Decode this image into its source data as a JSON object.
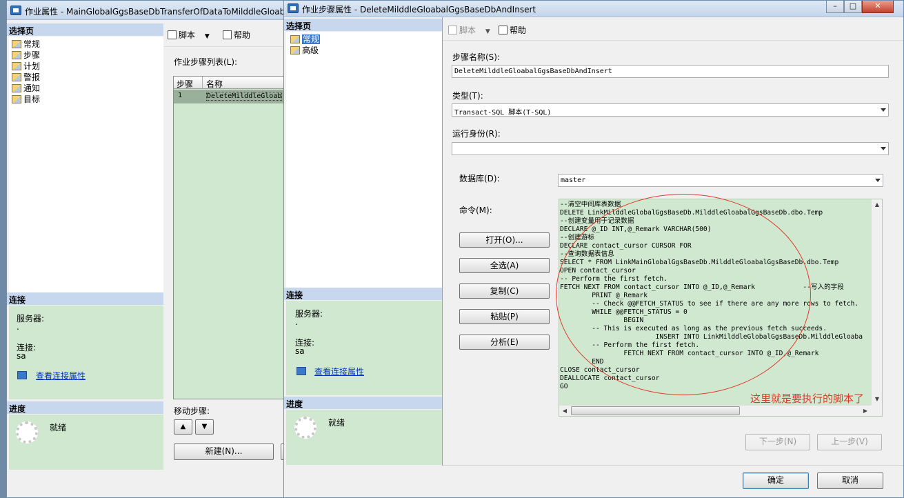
{
  "back_window": {
    "title": "作业属性 - MainGlobalGgsBaseDbTransferOfDataToMilddleGloab",
    "select_page_header": "选择页",
    "nav": [
      "常规",
      "步骤",
      "计划",
      "警报",
      "通知",
      "目标"
    ],
    "toolbar": {
      "script": "脚本",
      "help": "帮助"
    },
    "step_list_label": "作业步骤列表(L):",
    "table": {
      "headers": [
        "步骤",
        "名称"
      ],
      "rows": [
        [
          "1",
          "DeleteMilddleGloab"
        ]
      ]
    },
    "connection_header": "连接",
    "server_label": "服务器:",
    "server_value": ".",
    "connection_label": "连接:",
    "connection_value": "sa",
    "view_connection_link": "查看连接属性",
    "progress_header": "进度",
    "progress_status": "就绪",
    "move_step_label": "移动步骤:",
    "new_button": "新建(N)..."
  },
  "front_window": {
    "title": "作业步骤属性 - DeleteMilddleGloabalGgsBaseDbAndInsert",
    "select_page_header": "选择页",
    "nav": [
      "常规",
      "高级"
    ],
    "toolbar": {
      "script": "脚本",
      "help": "帮助"
    },
    "step_name_label": "步骤名称(S):",
    "step_name_value": "DeleteMilddleGloabalGgsBaseDbAndInsert",
    "type_label": "类型(T):",
    "type_value": "Transact-SQL 脚本(T-SQL)",
    "run_as_label": "运行身份(R):",
    "run_as_value": "",
    "database_label": "数据库(D):",
    "database_value": "master",
    "command_label": "命令(M):",
    "buttons": {
      "open": "打开(O)...",
      "select_all": "全选(A)",
      "copy": "复制(C)",
      "paste": "粘贴(P)",
      "parse": "分析(E)",
      "next": "下一步(N)",
      "prev": "上一步(V)",
      "ok": "确定",
      "cancel": "取消"
    },
    "connection_header": "连接",
    "server_label": "服务器:",
    "server_value": ".",
    "connection_label": "连接:",
    "connection_value": "sa",
    "view_connection_link": "查看连接属性",
    "progress_header": "进度",
    "progress_status": "就绪",
    "command_lines": [
      "--清空中间库表数据",
      "DELETE LinkMilddleGlobalGgsBaseDb.MilddleGloabalGgsBaseDb.dbo.Temp",
      "--创建变量用于记录数据",
      "DECLARE @_ID INT,@_Remark VARCHAR(500)",
      "--创建游标",
      "DECLARE contact_cursor CURSOR FOR",
      "--查询数据表信息",
      "SELECT * FROM LinkMainGlobalGgsBaseDb.MilddleGloabalGgsBaseDb.dbo.Temp",
      "OPEN contact_cursor",
      "-- Perform the first fetch.",
      "FETCH NEXT FROM contact_cursor INTO @_ID,@_Remark            --写入的字段",
      "        PRINT @_Remark",
      "        -- Check @@FETCH_STATUS to see if there are any more rows to fetch.",
      "        WHILE @@FETCH_STATUS = 0",
      "                BEGIN",
      "        -- This is executed as long as the previous fetch succeeds.",
      "                        INSERT INTO LinkMilddleGlobalGgsBaseDb.MilddleGloaba",
      "        -- Perform the first fetch.",
      "                FETCH NEXT FROM contact_cursor INTO @_ID,@_Remark",
      "        END",
      "CLOSE contact_cursor",
      "DEALLOCATE contact_cursor",
      "GO"
    ],
    "annotation": "这里就是要执行的脚本了"
  },
  "colors": {
    "green_pane": "#cfe8cf",
    "header_blue": "#c7d8ee",
    "annotation_red": "#e23a2a",
    "link_blue": "#0033cc"
  }
}
